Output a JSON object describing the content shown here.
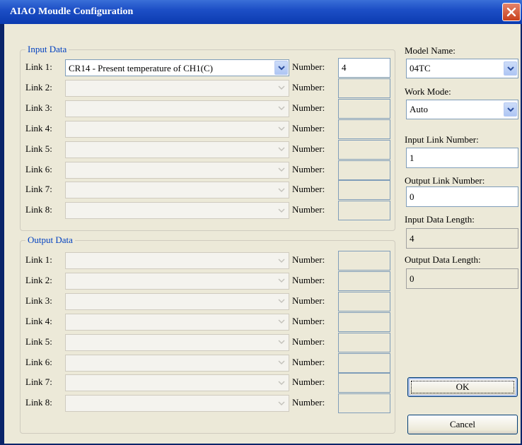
{
  "window": {
    "title": "AIAO Moudle Configuration"
  },
  "input_group": {
    "legend": "Input Data",
    "rows": [
      {
        "label": "Link 1:",
        "value": "CR14 - Present temperature of CH1(C)",
        "number_label": "Number:",
        "number": "4",
        "enabled": true
      },
      {
        "label": "Link 2:",
        "value": "",
        "number_label": "Number:",
        "number": "",
        "enabled": false
      },
      {
        "label": "Link 3:",
        "value": "",
        "number_label": "Number:",
        "number": "",
        "enabled": false
      },
      {
        "label": "Link 4:",
        "value": "",
        "number_label": "Number:",
        "number": "",
        "enabled": false
      },
      {
        "label": "Link 5:",
        "value": "",
        "number_label": "Number:",
        "number": "",
        "enabled": false
      },
      {
        "label": "Link 6:",
        "value": "",
        "number_label": "Number:",
        "number": "",
        "enabled": false
      },
      {
        "label": "Link 7:",
        "value": "",
        "number_label": "Number:",
        "number": "",
        "enabled": false
      },
      {
        "label": "Link 8:",
        "value": "",
        "number_label": "Number:",
        "number": "",
        "enabled": false
      }
    ]
  },
  "output_group": {
    "legend": "Output Data",
    "rows": [
      {
        "label": "Link 1:",
        "value": "",
        "number_label": "Number:",
        "number": "",
        "enabled": false
      },
      {
        "label": "Link 2:",
        "value": "",
        "number_label": "Number:",
        "number": "",
        "enabled": false
      },
      {
        "label": "Link 3:",
        "value": "",
        "number_label": "Number:",
        "number": "",
        "enabled": false
      },
      {
        "label": "Link 4:",
        "value": "",
        "number_label": "Number:",
        "number": "",
        "enabled": false
      },
      {
        "label": "Link 5:",
        "value": "",
        "number_label": "Number:",
        "number": "",
        "enabled": false
      },
      {
        "label": "Link 6:",
        "value": "",
        "number_label": "Number:",
        "number": "",
        "enabled": false
      },
      {
        "label": "Link 7:",
        "value": "",
        "number_label": "Number:",
        "number": "",
        "enabled": false
      },
      {
        "label": "Link 8:",
        "value": "",
        "number_label": "Number:",
        "number": "",
        "enabled": false
      }
    ]
  },
  "right_panel": {
    "model_name_label": "Model Name:",
    "model_name_value": "04TC",
    "work_mode_label": "Work Mode:",
    "work_mode_value": "Auto",
    "input_link_number_label": "Input Link Number:",
    "input_link_number_value": "1",
    "output_link_number_label": "Output Link Number:",
    "output_link_number_value": "0",
    "input_data_length_label": "Input Data Length:",
    "input_data_length_value": "4",
    "output_data_length_label": "Output Data Length:",
    "output_data_length_value": "0"
  },
  "buttons": {
    "ok": "OK",
    "cancel": "Cancel"
  },
  "colors": {
    "titlebar": "#0b3bb0",
    "legend_text": "#0040c0",
    "dialog_bg": "#ece9d8"
  },
  "icons": {
    "close": "close-icon",
    "dropdown": "chevron-down-icon"
  }
}
